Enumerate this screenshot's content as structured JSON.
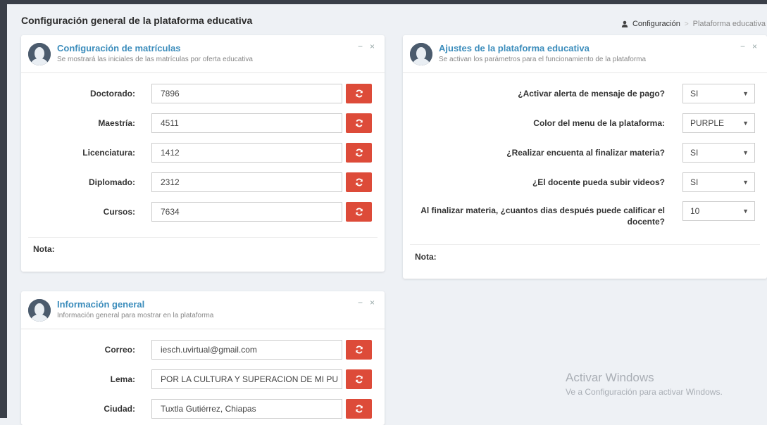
{
  "header": {
    "title": "Configuración general de la plataforma educativa",
    "breadcrumb": [
      "Configuración",
      "Plataforma educativa"
    ]
  },
  "matriculas": {
    "title": "Configuración de matrículas",
    "subtitle": "Se mostrará las iniciales de las matrículas por oferta educativa",
    "rows": [
      {
        "label": "Doctorado:",
        "value": "7896"
      },
      {
        "label": "Maestría:",
        "value": "4511"
      },
      {
        "label": "Licenciatura:",
        "value": "1412"
      },
      {
        "label": "Diplomado:",
        "value": "2312"
      },
      {
        "label": "Cursos:",
        "value": "7634"
      }
    ],
    "note": "Nota:"
  },
  "ajustes": {
    "title": "Ajustes de la plataforma educativa",
    "subtitle": "Se activan los parámetros para el funcionamiento de la plataforma",
    "rows": [
      {
        "label": "¿Activar alerta de mensaje de pago?",
        "value": "SI"
      },
      {
        "label": "Color del menu de la plataforma:",
        "value": "PURPLE"
      },
      {
        "label": "¿Realizar encuenta al finalizar materia?",
        "value": "SI"
      },
      {
        "label": "¿El docente pueda subir videos?",
        "value": "SI"
      },
      {
        "label": "Al finalizar materia, ¿cuantos dias después puede calificar el docente?",
        "value": "10"
      }
    ],
    "note": "Nota:"
  },
  "info": {
    "title": "Información general",
    "subtitle": "Información general para mostrar en la plataforma",
    "rows": [
      {
        "label": "Correo:",
        "value": "iesch.uvirtual@gmail.com"
      },
      {
        "label": "Lema:",
        "value": "POR LA CULTURA Y SUPERACION DE MI PU"
      },
      {
        "label": "Ciudad:",
        "value": "Tuxtla Gutiérrez, Chiapas"
      }
    ]
  },
  "tools": {
    "minimize": "−",
    "close": "×"
  },
  "watermark": {
    "line1": "Activar Windows",
    "line2": "Ve a Configuración para activar Windows."
  },
  "colors": {
    "accent": "#3c8dbc",
    "danger": "#dd4b39"
  }
}
